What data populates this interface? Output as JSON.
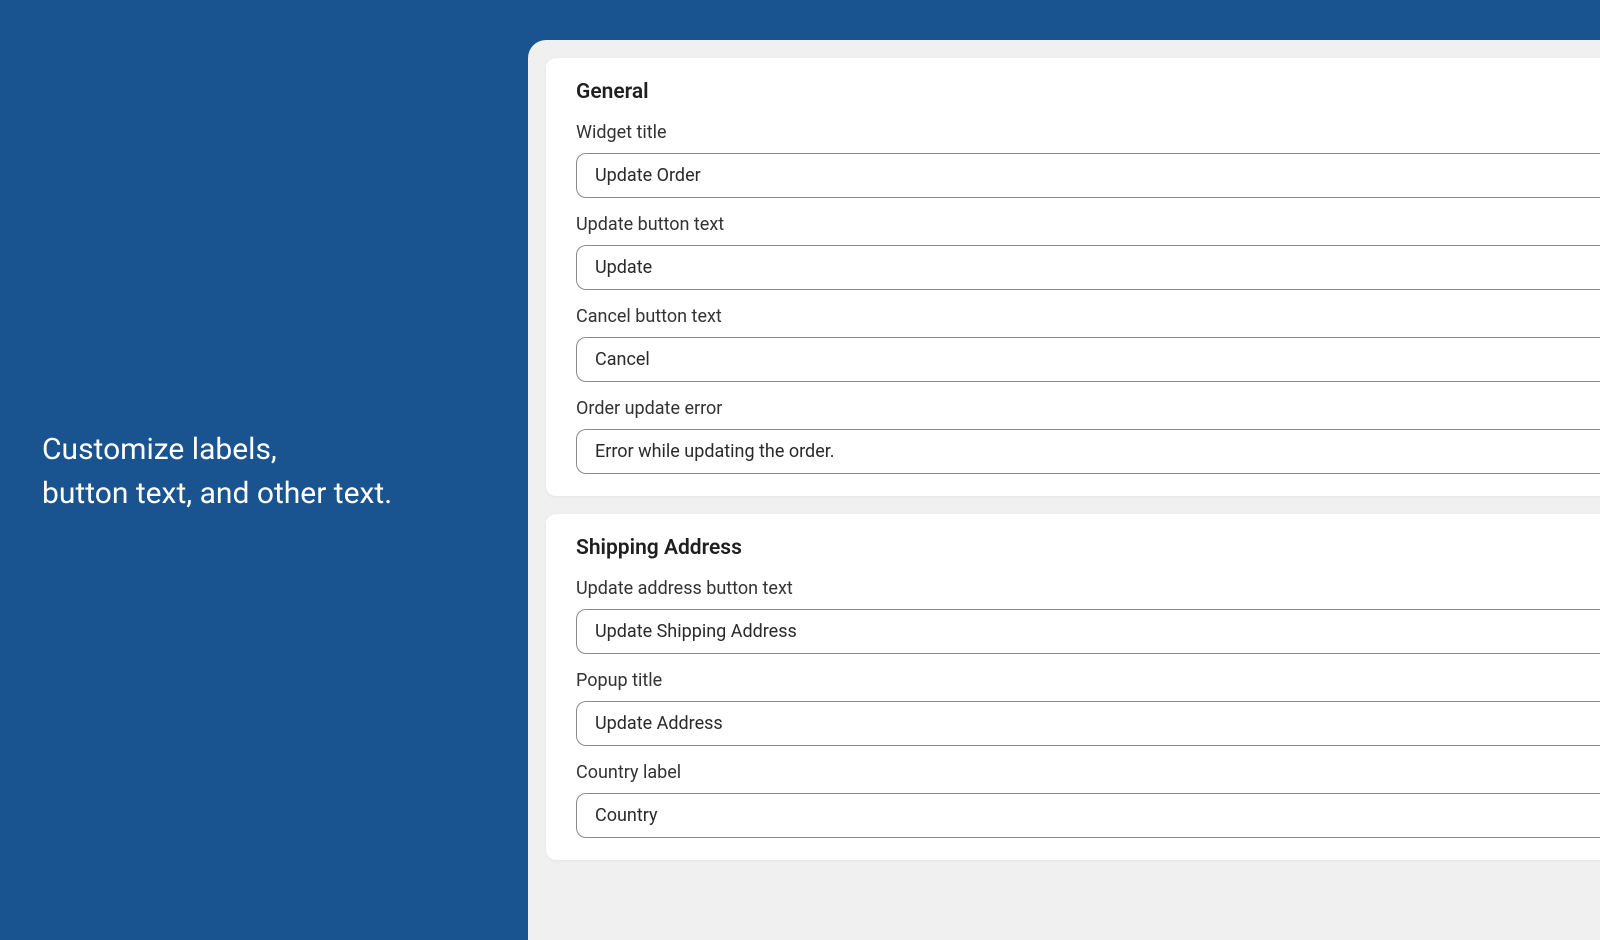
{
  "sidebar": {
    "line1": "Customize labels,",
    "line2": "button text, and other text."
  },
  "sections": {
    "general": {
      "title": "General",
      "fields": {
        "widget_title": {
          "label": "Widget title",
          "value": "Update Order"
        },
        "update_button_text": {
          "label": "Update button text",
          "value": "Update"
        },
        "cancel_button_text": {
          "label": "Cancel button text",
          "value": "Cancel"
        },
        "order_update_error": {
          "label": "Order update error",
          "value": "Error while updating the order."
        }
      }
    },
    "shipping_address": {
      "title": "Shipping Address",
      "fields": {
        "update_address_button_text": {
          "label": "Update address button text",
          "value": "Update Shipping Address"
        },
        "popup_title": {
          "label": "Popup title",
          "value": "Update Address"
        },
        "country_label": {
          "label": "Country label",
          "value": "Country"
        }
      }
    }
  }
}
